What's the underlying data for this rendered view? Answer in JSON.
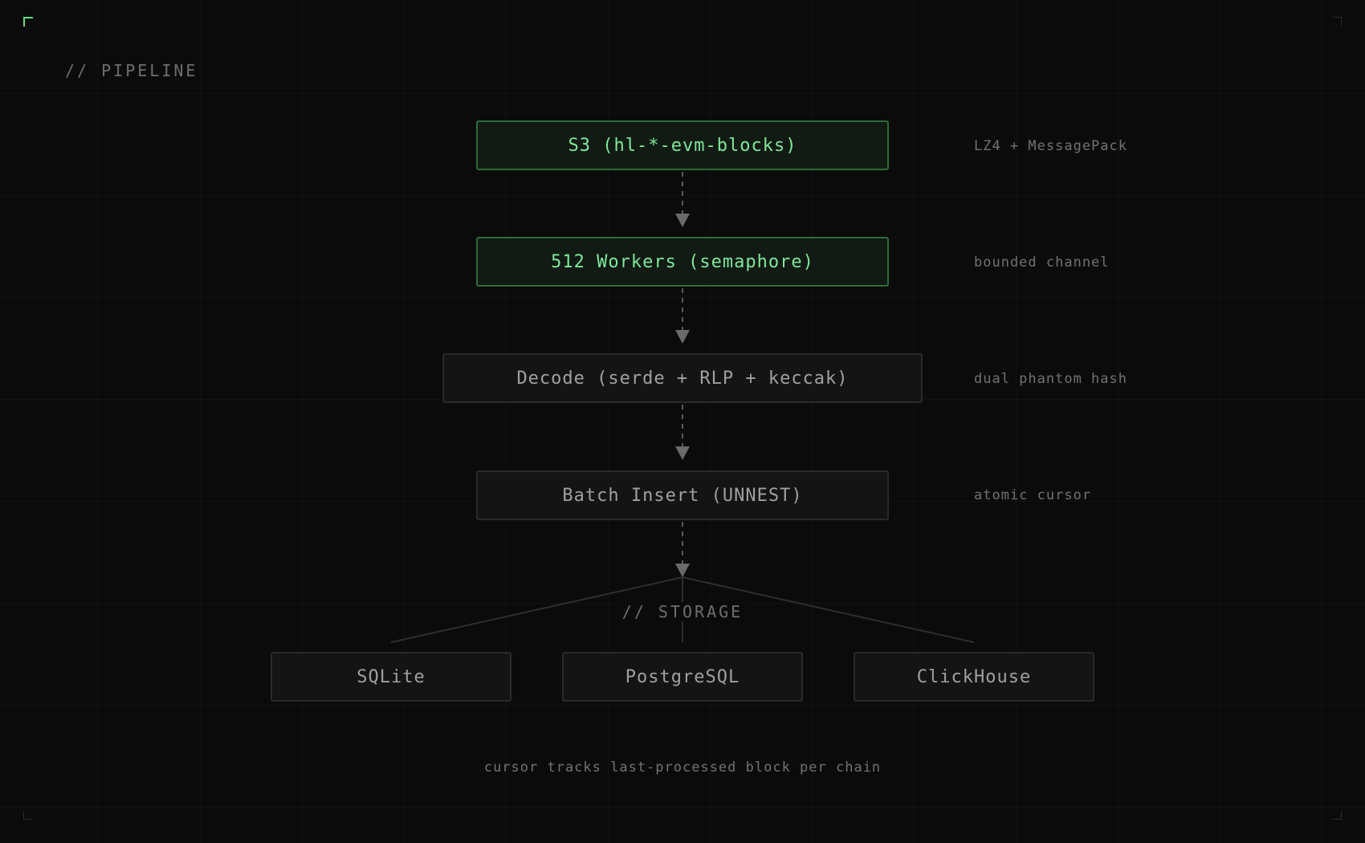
{
  "colors": {
    "background": "#0b0b0b",
    "accent_green": "#7fe89b",
    "active_border": "#2e6b3a",
    "idle_border": "#2a2a2a",
    "muted_text": "#727272",
    "connector": "#6a6a6a"
  },
  "sections": {
    "pipeline": "// PIPELINE",
    "storage": "// STORAGE"
  },
  "stages": [
    {
      "label": "S3 (hl-*-evm-blocks)",
      "note": "LZ4 + MessagePack",
      "state": "active"
    },
    {
      "label": "512 Workers (semaphore)",
      "note": "bounded channel",
      "state": "active"
    },
    {
      "label": "Decode (serde + RLP + keccak)",
      "note": "dual phantom hash",
      "state": "idle"
    },
    {
      "label": "Batch Insert (UNNEST)",
      "note": "atomic cursor",
      "state": "idle"
    }
  ],
  "storage": [
    {
      "label": "SQLite"
    },
    {
      "label": "PostgreSQL"
    },
    {
      "label": "ClickHouse"
    }
  ],
  "footer_note": "cursor tracks last-processed block per chain"
}
